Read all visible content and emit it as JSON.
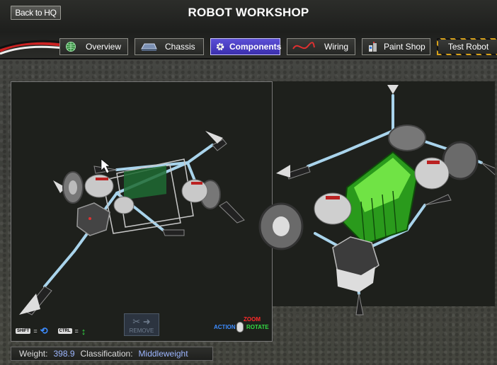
{
  "header": {
    "title": "ROBOT WORKSHOP",
    "back_label": "Back to HQ"
  },
  "tabs": [
    {
      "label": "Overview",
      "icon": "globe-icon"
    },
    {
      "label": "Chassis",
      "icon": "chassis-icon"
    },
    {
      "label": "Components",
      "icon": "gear-icon",
      "active": true
    },
    {
      "label": "Wiring",
      "icon": "wire-icon"
    },
    {
      "label": "Paint Shop",
      "icon": "paint-cans-icon"
    },
    {
      "label": "Test Robot",
      "icon": "none"
    }
  ],
  "viewport": {
    "hud": {
      "shift_key": "SHIFT",
      "ctrl_key": "CTRL",
      "equals": "=",
      "remove_label": "REMOVE",
      "action_label": "ACTION",
      "zoom_label": "ZOOM",
      "rotate_label": "ROTATE"
    }
  },
  "status": {
    "weight_label": "Weight:",
    "weight_value": "398.9",
    "class_label": "Classification:",
    "class_value": "Middleweight"
  },
  "colors": {
    "active_tab": "#4a3fc9",
    "info_value": "#9db6ff",
    "battery_green": "#5ed62e",
    "strut_blue": "#a9d4ec",
    "zoom_red": "#ff2a2a",
    "rotate_green": "#33dd44",
    "action_blue": "#3d8cff"
  }
}
